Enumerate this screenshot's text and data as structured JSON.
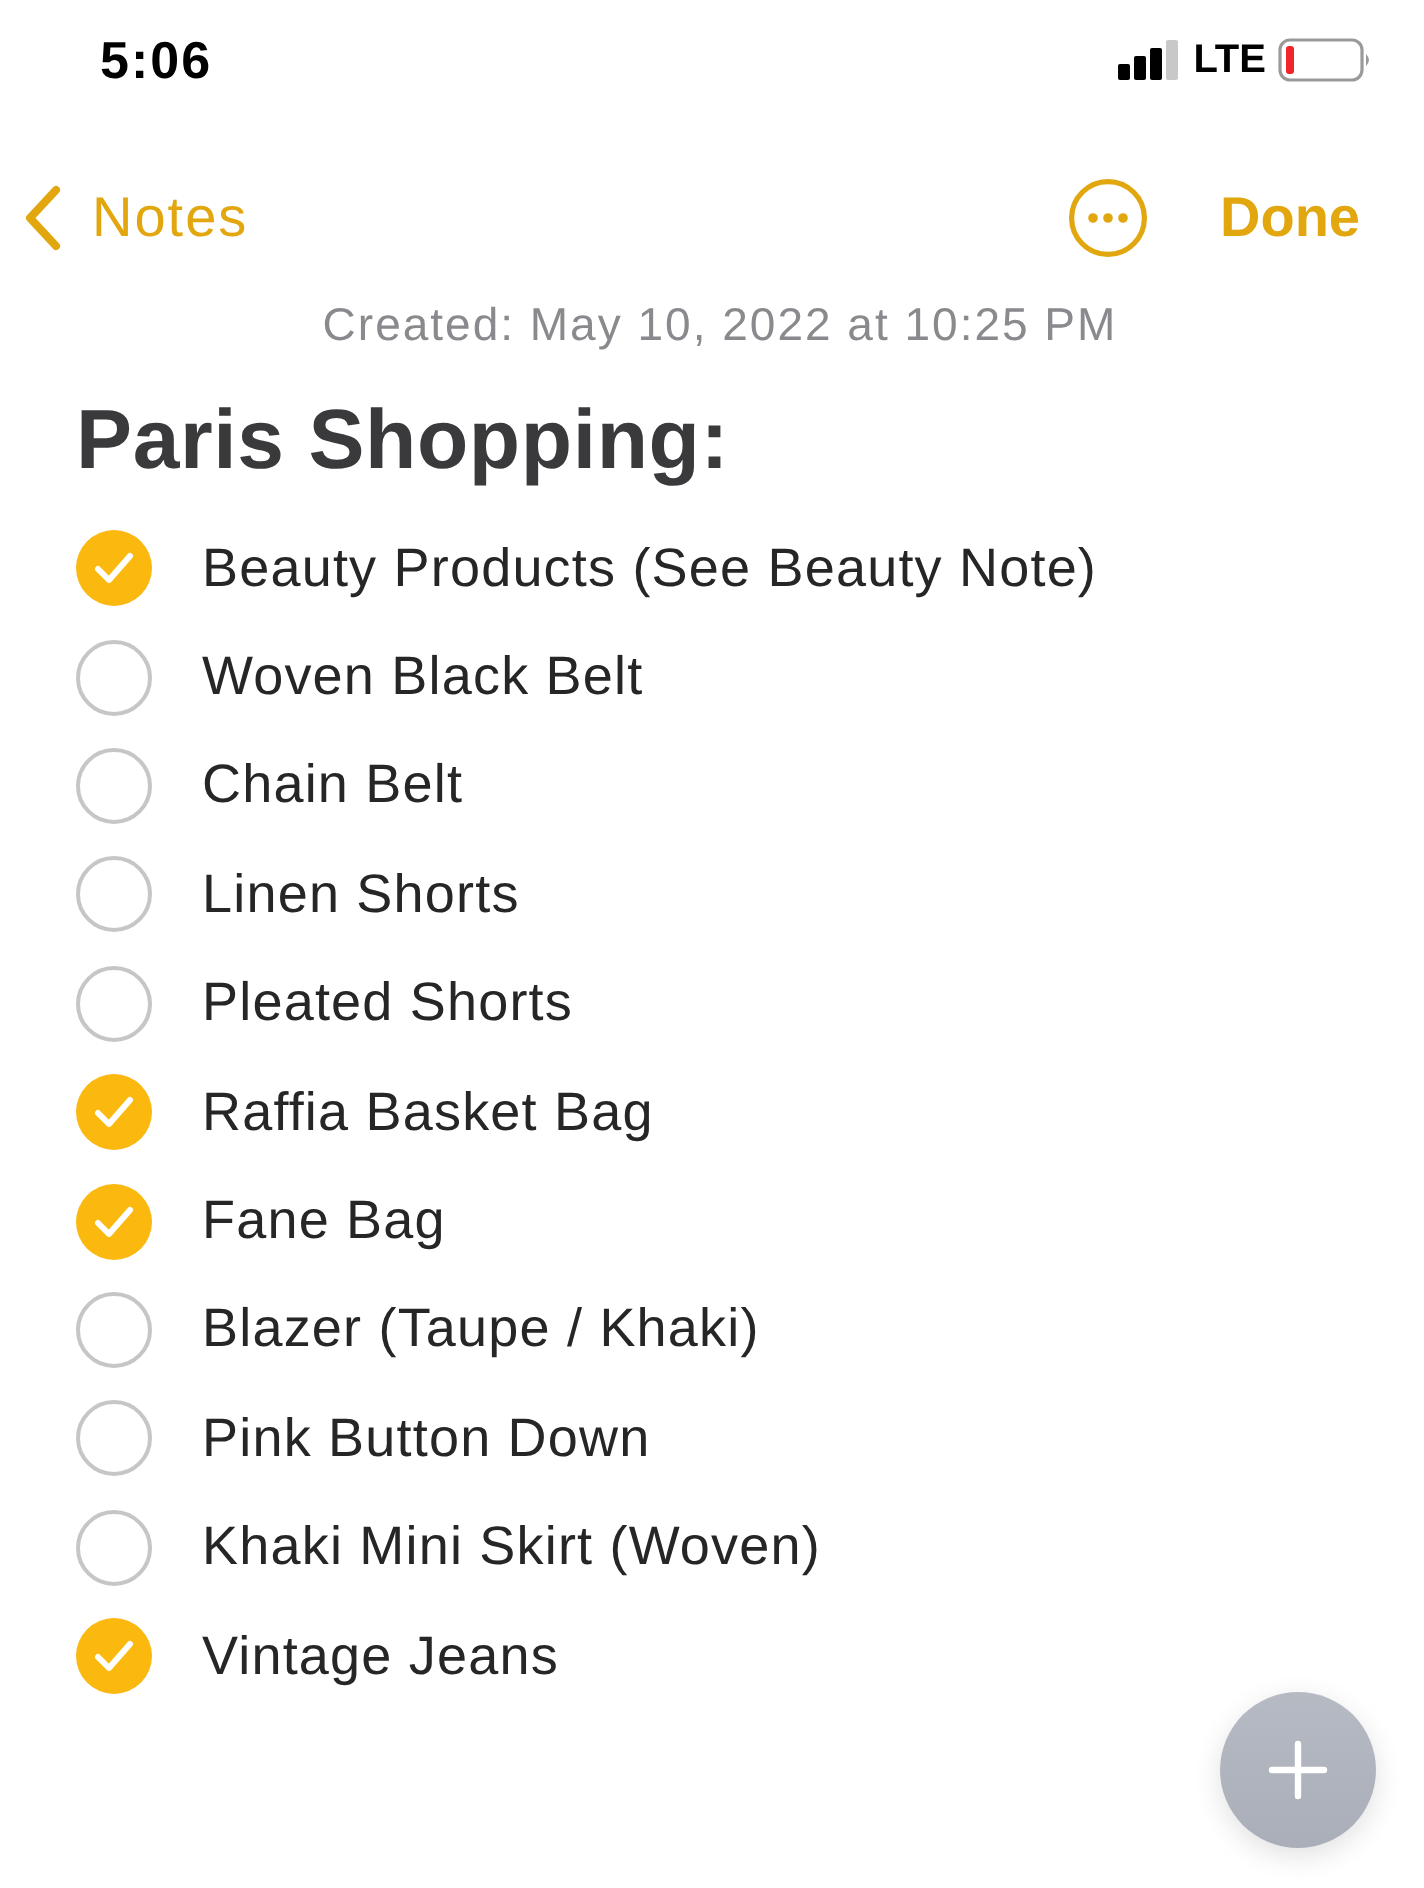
{
  "status_bar": {
    "time": "5:06",
    "network": "LTE"
  },
  "nav": {
    "back_label": "Notes",
    "done_label": "Done"
  },
  "note": {
    "created": "Created: May 10, 2022 at 10:25 PM",
    "title": "Paris Shopping:",
    "items": [
      {
        "text": "Beauty Products (See Beauty Note)",
        "checked": true
      },
      {
        "text": "Woven Black Belt",
        "checked": false
      },
      {
        "text": "Chain Belt",
        "checked": false
      },
      {
        "text": "Linen Shorts",
        "checked": false
      },
      {
        "text": "Pleated Shorts",
        "checked": false
      },
      {
        "text": "Raffia Basket Bag",
        "checked": true
      },
      {
        "text": "Fane Bag",
        "checked": true
      },
      {
        "text": "Blazer (Taupe / Khaki)",
        "checked": false
      },
      {
        "text": "Pink Button Down",
        "checked": false
      },
      {
        "text": "Khaki Mini Skirt (Woven)",
        "checked": false
      },
      {
        "text": "Vintage Jeans",
        "checked": true
      }
    ]
  }
}
